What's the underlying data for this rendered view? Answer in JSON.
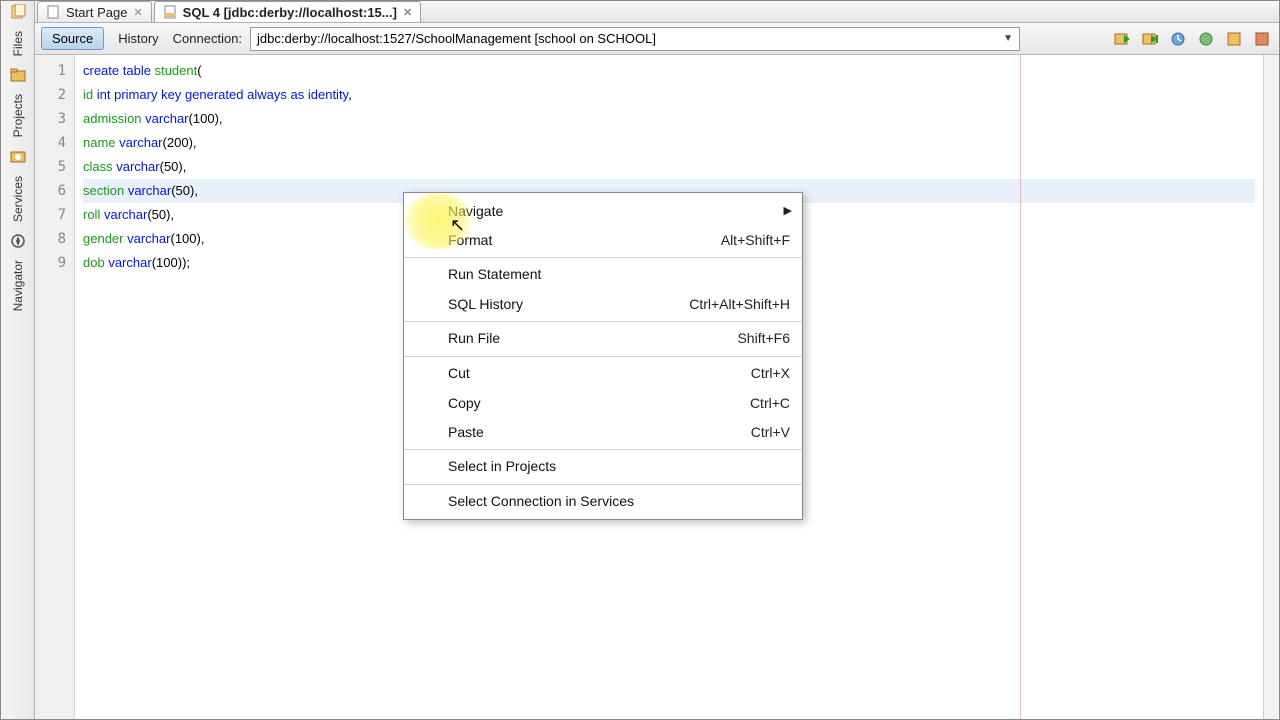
{
  "tabs": [
    {
      "label": "Start Page",
      "active": false
    },
    {
      "label": "SQL 4 [jdbc:derby://localhost:15...]",
      "active": true
    }
  ],
  "toolbar": {
    "source": "Source",
    "history": "History",
    "connection_label": "Connection:",
    "connection_value": "jdbc:derby://localhost:1527/SchoolManagement [school on SCHOOL]"
  },
  "side_panels": [
    "Files",
    "Projects",
    "Services",
    "Navigator"
  ],
  "code_lines": [
    {
      "n": 1,
      "tokens": [
        [
          "kw",
          "create"
        ],
        [
          "pun",
          " "
        ],
        [
          "kw",
          "table"
        ],
        [
          "pun",
          " "
        ],
        [
          "idn",
          "student"
        ],
        [
          "pun",
          "("
        ]
      ]
    },
    {
      "n": 2,
      "tokens": [
        [
          "idn",
          "id"
        ],
        [
          "pun",
          " "
        ],
        [
          "typ",
          "int"
        ],
        [
          "pun",
          " "
        ],
        [
          "kw",
          "primary"
        ],
        [
          "pun",
          " "
        ],
        [
          "kw",
          "key"
        ],
        [
          "pun",
          " "
        ],
        [
          "kw",
          "generated"
        ],
        [
          "pun",
          " "
        ],
        [
          "kw",
          "always"
        ],
        [
          "pun",
          " "
        ],
        [
          "kw",
          "as"
        ],
        [
          "pun",
          " "
        ],
        [
          "kw",
          "identity"
        ],
        [
          "pun",
          ","
        ]
      ]
    },
    {
      "n": 3,
      "tokens": [
        [
          "idn",
          "admission"
        ],
        [
          "pun",
          " "
        ],
        [
          "typ",
          "varchar"
        ],
        [
          "pun",
          "("
        ],
        [
          "num",
          "100"
        ],
        [
          "pun",
          "),"
        ]
      ]
    },
    {
      "n": 4,
      "tokens": [
        [
          "idn",
          "name"
        ],
        [
          "pun",
          " "
        ],
        [
          "typ",
          "varchar"
        ],
        [
          "pun",
          "("
        ],
        [
          "num",
          "200"
        ],
        [
          "pun",
          "),"
        ]
      ]
    },
    {
      "n": 5,
      "tokens": [
        [
          "idn",
          "class"
        ],
        [
          "pun",
          " "
        ],
        [
          "typ",
          "varchar"
        ],
        [
          "pun",
          "("
        ],
        [
          "num",
          "50"
        ],
        [
          "pun",
          "),"
        ]
      ]
    },
    {
      "n": 6,
      "tokens": [
        [
          "idn",
          "section"
        ],
        [
          "pun",
          " "
        ],
        [
          "typ",
          "varchar"
        ],
        [
          "pun",
          "("
        ],
        [
          "num",
          "50"
        ],
        [
          "pun",
          "),"
        ]
      ],
      "hl": true
    },
    {
      "n": 7,
      "tokens": [
        [
          "idn",
          "roll"
        ],
        [
          "pun",
          " "
        ],
        [
          "typ",
          "varchar"
        ],
        [
          "pun",
          "("
        ],
        [
          "num",
          "50"
        ],
        [
          "pun",
          "),"
        ]
      ]
    },
    {
      "n": 8,
      "tokens": [
        [
          "idn",
          "gender"
        ],
        [
          "pun",
          " "
        ],
        [
          "typ",
          "varchar"
        ],
        [
          "pun",
          "("
        ],
        [
          "num",
          "100"
        ],
        [
          "pun",
          "),"
        ]
      ]
    },
    {
      "n": 9,
      "tokens": [
        [
          "idn",
          "dob"
        ],
        [
          "pun",
          " "
        ],
        [
          "typ",
          "varchar"
        ],
        [
          "pun",
          "("
        ],
        [
          "num",
          "100"
        ],
        [
          "pun",
          "));"
        ]
      ]
    }
  ],
  "context_menu": [
    {
      "label": "Navigate",
      "submenu": true
    },
    {
      "label": "Format",
      "shortcut": "Alt+Shift+F"
    },
    {
      "label": "Run Statement",
      "section": true
    },
    {
      "label": "SQL History",
      "shortcut": "Ctrl+Alt+Shift+H"
    },
    {
      "label": "Run File",
      "shortcut": "Shift+F6",
      "section": true
    },
    {
      "label": "Cut",
      "shortcut": "Ctrl+X",
      "section": true
    },
    {
      "label": "Copy",
      "shortcut": "Ctrl+C"
    },
    {
      "label": "Paste",
      "shortcut": "Ctrl+V"
    },
    {
      "label": "Select in Projects",
      "section": true
    },
    {
      "label": "Select Connection in Services",
      "section": true
    }
  ]
}
